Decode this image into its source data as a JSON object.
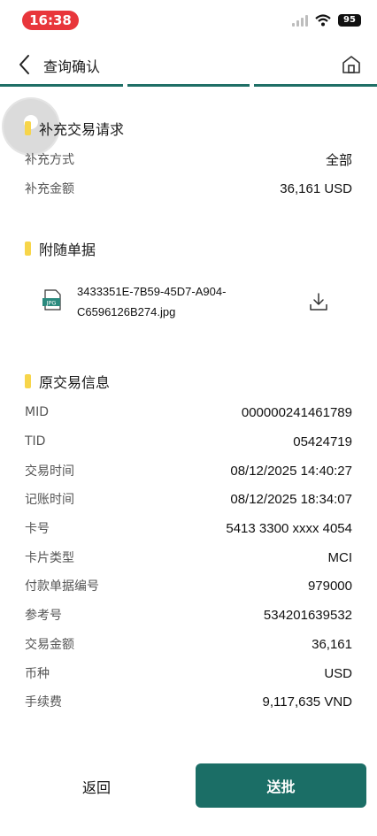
{
  "status_bar": {
    "time": "16:38",
    "battery": "95"
  },
  "header": {
    "title": "查询确认"
  },
  "supplement": {
    "title": "补充交易请求",
    "rows": [
      {
        "label": "补充方式",
        "value": "全部"
      },
      {
        "label": "补充金额",
        "value": "36,161 USD"
      }
    ]
  },
  "attachments": {
    "title": "附随单据",
    "file_icon_text": "JPG",
    "file_name_line1": "3433351E-7B59-45D7-A904-",
    "file_name_line2": "C6596126B274.jpg"
  },
  "original": {
    "title": "原交易信息",
    "rows": [
      {
        "label": "MID",
        "value": "000000241461789"
      },
      {
        "label": "TID",
        "value": "05424719"
      },
      {
        "label": "交易时间",
        "value": "08/12/2025 14:40:27"
      },
      {
        "label": "记账时间",
        "value": "08/12/2025 18:34:07"
      },
      {
        "label": "卡号",
        "value": "5413 3300 xxxx 4054"
      },
      {
        "label": "卡片类型",
        "value": "MCI"
      },
      {
        "label": "付款单据编号",
        "value": "979000"
      },
      {
        "label": "参考号",
        "value": "534201639532"
      },
      {
        "label": "交易金额",
        "value": "36,161"
      },
      {
        "label": "币种",
        "value": "USD"
      },
      {
        "label": "手续费",
        "value": "9,117,635 VND"
      }
    ]
  },
  "footer": {
    "back_label": "返回",
    "submit_label": "送批"
  },
  "colors": {
    "primary": "#1b6e66",
    "accent_bar": "#f7d54a",
    "time_pill": "#e8363b"
  }
}
